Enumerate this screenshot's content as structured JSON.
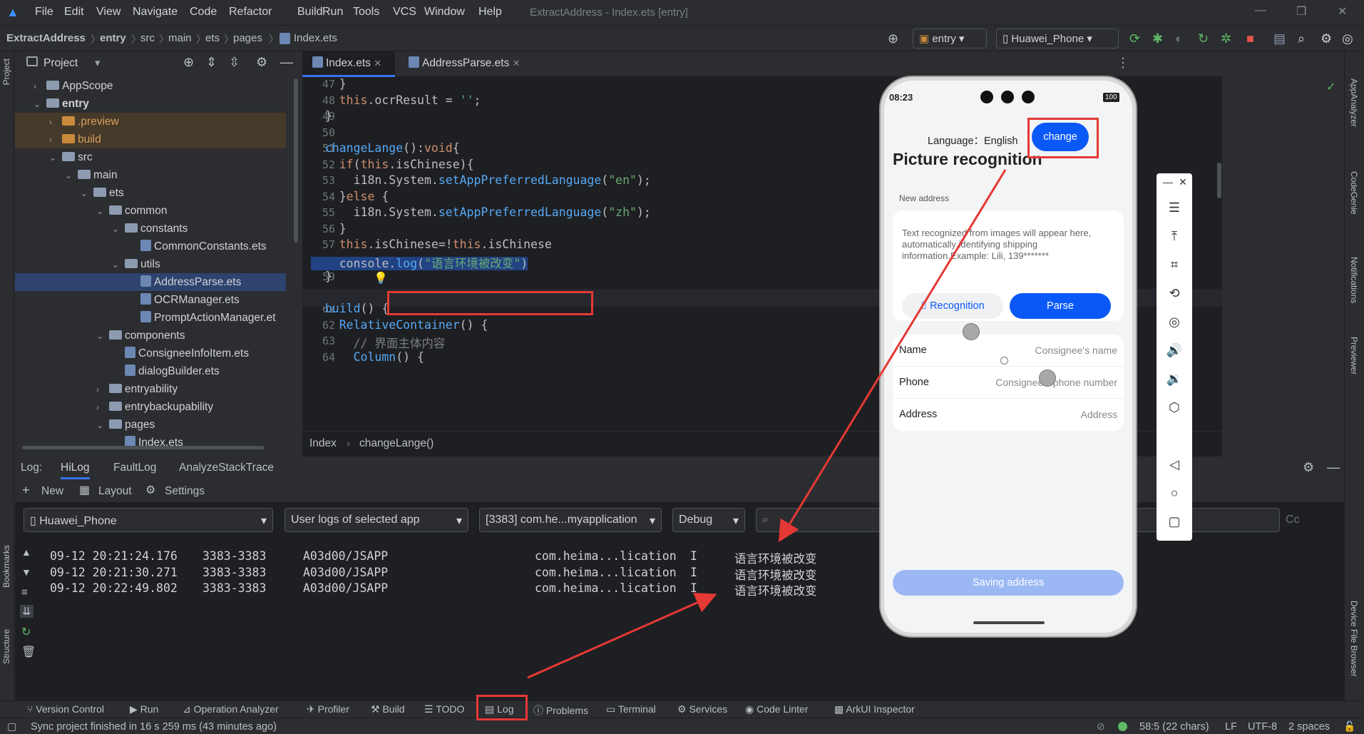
{
  "window": {
    "menu": [
      "File",
      "Edit",
      "View",
      "Navigate",
      "Code",
      "Refactor",
      "Build",
      "Run",
      "Tools",
      "VCS",
      "Window",
      "Help"
    ],
    "title": "ExtractAddress - Index.ets [entry]"
  },
  "breadcrumb": [
    "ExtractAddress",
    "entry",
    "src",
    "main",
    "ets",
    "pages",
    "Index.ets"
  ],
  "toolbar": {
    "module": "entry",
    "device": "Huawei_Phone"
  },
  "project_panel": {
    "title": "Project",
    "tree": [
      {
        "label": "AppScope",
        "indent": 0,
        "type": "folder",
        "arrow": "›"
      },
      {
        "label": "entry",
        "indent": 0,
        "type": "folder",
        "arrow": "⌄"
      },
      {
        "label": ".preview",
        "indent": 1,
        "type": "folder-orange",
        "arrow": "›"
      },
      {
        "label": "build",
        "indent": 1,
        "type": "folder-orange",
        "arrow": "›"
      },
      {
        "label": "src",
        "indent": 1,
        "type": "folder",
        "arrow": "⌄"
      },
      {
        "label": "main",
        "indent": 2,
        "type": "folder",
        "arrow": "⌄"
      },
      {
        "label": "ets",
        "indent": 3,
        "type": "folder",
        "arrow": "⌄"
      },
      {
        "label": "common",
        "indent": 4,
        "type": "folder",
        "arrow": "⌄"
      },
      {
        "label": "constants",
        "indent": 5,
        "type": "folder",
        "arrow": "⌄"
      },
      {
        "label": "CommonConstants.ets",
        "indent": 6,
        "type": "file",
        "arrow": ""
      },
      {
        "label": "utils",
        "indent": 5,
        "type": "folder",
        "arrow": "⌄"
      },
      {
        "label": "AddressParse.ets",
        "indent": 6,
        "type": "file",
        "arrow": ""
      },
      {
        "label": "OCRManager.ets",
        "indent": 6,
        "type": "file",
        "arrow": ""
      },
      {
        "label": "PromptActionManager.et",
        "indent": 6,
        "type": "file",
        "arrow": ""
      },
      {
        "label": "components",
        "indent": 4,
        "type": "folder",
        "arrow": "⌄"
      },
      {
        "label": "ConsigneeInfoItem.ets",
        "indent": 5,
        "type": "file",
        "arrow": ""
      },
      {
        "label": "dialogBuilder.ets",
        "indent": 5,
        "type": "file",
        "arrow": ""
      },
      {
        "label": "entryability",
        "indent": 4,
        "type": "folder",
        "arrow": "›"
      },
      {
        "label": "entrybackupability",
        "indent": 4,
        "type": "folder",
        "arrow": "›"
      },
      {
        "label": "pages",
        "indent": 4,
        "type": "folder",
        "arrow": "⌄"
      },
      {
        "label": "Index.ets",
        "indent": 5,
        "type": "file",
        "arrow": ""
      }
    ]
  },
  "editor": {
    "tabs": [
      "Index.ets",
      "AddressParse.ets"
    ],
    "line_numbers": [
      "47",
      "48",
      "49",
      "50",
      "51",
      "52",
      "53",
      "54",
      "55",
      "56",
      "57",
      "58",
      "59",
      "60",
      "61",
      "62",
      "63",
      "64"
    ],
    "code": [
      [
        {
          "t": "    }",
          "c": "paren"
        }
      ],
      [
        {
          "t": "    ",
          "c": ""
        },
        {
          "t": "this",
          "c": "kw"
        },
        {
          "t": ".ocrResult = ",
          "c": ""
        },
        {
          "t": "''",
          "c": "str"
        },
        {
          "t": ";",
          "c": ""
        }
      ],
      [
        {
          "t": "  }",
          "c": "paren"
        }
      ],
      [
        {
          "t": "",
          "c": ""
        }
      ],
      [
        {
          "t": "  ",
          "c": ""
        },
        {
          "t": "changeLange",
          "c": "fn"
        },
        {
          "t": "():",
          "c": ""
        },
        {
          "t": "void",
          "c": "kw"
        },
        {
          "t": "{",
          "c": ""
        }
      ],
      [
        {
          "t": "    ",
          "c": ""
        },
        {
          "t": "if",
          "c": "kw"
        },
        {
          "t": "(",
          "c": ""
        },
        {
          "t": "this",
          "c": "kw"
        },
        {
          "t": ".isChinese){",
          "c": ""
        }
      ],
      [
        {
          "t": "      i18n.System.",
          "c": ""
        },
        {
          "t": "setAppPreferredLanguage",
          "c": "fn"
        },
        {
          "t": "(",
          "c": ""
        },
        {
          "t": "\"en\"",
          "c": "str"
        },
        {
          "t": ");",
          "c": ""
        }
      ],
      [
        {
          "t": "    }",
          "c": ""
        },
        {
          "t": "else",
          "c": "kw"
        },
        {
          "t": " {",
          "c": ""
        }
      ],
      [
        {
          "t": "      i18n.System.",
          "c": ""
        },
        {
          "t": "setAppPreferredLanguage",
          "c": "fn"
        },
        {
          "t": "(",
          "c": ""
        },
        {
          "t": "\"zh\"",
          "c": "str"
        },
        {
          "t": ");",
          "c": ""
        }
      ],
      [
        {
          "t": "    }",
          "c": ""
        }
      ],
      [
        {
          "t": "    ",
          "c": ""
        },
        {
          "t": "this",
          "c": "kw"
        },
        {
          "t": ".isChinese=!",
          "c": ""
        },
        {
          "t": "this",
          "c": "kw"
        },
        {
          "t": ".isChinese",
          "c": ""
        }
      ],
      [
        {
          "t": "    console.",
          "c": ""
        },
        {
          "t": "log",
          "c": "fn"
        },
        {
          "t": "(",
          "c": ""
        },
        {
          "t": "\"语言环境被改变\"",
          "c": "str"
        },
        {
          "t": ")",
          "c": ""
        }
      ],
      [
        {
          "t": "  }",
          "c": ""
        }
      ],
      [
        {
          "t": "",
          "c": ""
        }
      ],
      [
        {
          "t": "  ",
          "c": ""
        },
        {
          "t": "build",
          "c": "fn"
        },
        {
          "t": "() {",
          "c": ""
        }
      ],
      [
        {
          "t": "    ",
          "c": ""
        },
        {
          "t": "RelativeContainer",
          "c": "fn"
        },
        {
          "t": "() {",
          "c": ""
        }
      ],
      [
        {
          "t": "      ",
          "c": ""
        },
        {
          "t": "// 界面主体内容",
          "c": "cm"
        }
      ],
      [
        {
          "t": "      ",
          "c": ""
        },
        {
          "t": "Column",
          "c": "fn"
        },
        {
          "t": "() {",
          "c": ""
        }
      ]
    ],
    "crumb": [
      "Index",
      "changeLange()"
    ]
  },
  "log": {
    "label": "Log:",
    "tabs": [
      "HiLog",
      "FaultLog",
      "AnalyzeStackTrace"
    ],
    "toolbar": [
      "New",
      "Layout",
      "Settings"
    ],
    "filters": {
      "device": "Huawei_Phone",
      "scope": "User logs of selected app",
      "process": "[3383] com.he...myapplication",
      "level": "Debug",
      "search_placeholder": "",
      "case": "Cc"
    },
    "lines": [
      {
        "time": "09-12 20:21:24.176",
        "pid": "3383-3383",
        "tag": "A03d00/JSAPP",
        "pkg": "com.heima...lication",
        "lvl": "I",
        "msg": "语言环境被改变"
      },
      {
        "time": "09-12 20:21:30.271",
        "pid": "3383-3383",
        "tag": "A03d00/JSAPP",
        "pkg": "com.heima...lication",
        "lvl": "I",
        "msg": "语言环境被改变"
      },
      {
        "time": "09-12 20:22:49.802",
        "pid": "3383-3383",
        "tag": "A03d00/JSAPP",
        "pkg": "com.heima...lication",
        "lvl": "I",
        "msg": "语言环境被改变"
      }
    ]
  },
  "bottom_tools": [
    "Version Control",
    "Run",
    "Operation Analyzer",
    "Profiler",
    "Build",
    "TODO",
    "Log",
    "Problems",
    "Terminal",
    "Services",
    "Code Linter",
    "ArkUI Inspector"
  ],
  "status": {
    "message": "Sync project finished in 16 s 259 ms (43 minutes ago)",
    "position": "58:5 (22 chars)",
    "line_ending": "LF",
    "encoding": "UTF-8",
    "indent": "2 spaces"
  },
  "left_stripe": [
    "Project",
    "Bookmarks",
    "Structure"
  ],
  "right_stripe": [
    "AppAnalyzer",
    "CodeGenie",
    "Notifications",
    "Previewer",
    "Device File Browser"
  ],
  "phone": {
    "time": "08:23",
    "battery": "100",
    "language_label": "Language：English",
    "change_button": "change",
    "title": "Picture recognition",
    "section_label": "New address",
    "ocr_placeholder": "Text recognized from images will appear here, automatically identifying shipping information.Example: Lili, 139*******",
    "recognition_button": "Recognition",
    "parse_button": "Parse",
    "fields": [
      {
        "label": "Name",
        "placeholder": "Consignee's name"
      },
      {
        "label": "Phone",
        "placeholder": "Consignee's phone number"
      },
      {
        "label": "Address",
        "placeholder": "Address"
      }
    ],
    "save_button": "Saving address"
  },
  "colors": {
    "accent": "#0a59f7",
    "highlight": "#e53935",
    "editor_bg": "#1e1f22",
    "panel_bg": "#2b2d30"
  }
}
